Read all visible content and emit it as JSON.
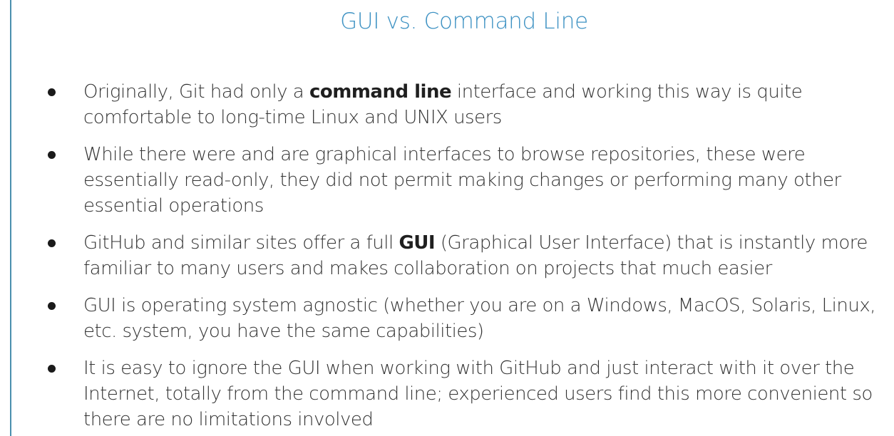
{
  "slide": {
    "title": "GUI vs. Command Line",
    "bullets": [
      {
        "before": "Originally, Git had only a ",
        "bold": "command line",
        "after": " interface and working this way is quite comfortable to long-time Linux and UNIX users"
      },
      {
        "text": "While there were and are graphical interfaces to browse repositories, these were essentially read-only, they did not permit making changes or performing many other essential operations"
      },
      {
        "before": "GitHub and similar sites offer a full ",
        "bold": "GUI",
        "after": " (Graphical User Interface) that is instantly more familiar to many users and makes collaboration on projects that much easier"
      },
      {
        "text": "GUI is operating system agnostic (whether you are on a Windows, MacOS, Solaris, Linux, etc. system, you have the same capabilities)"
      },
      {
        "text": "It is easy to ignore the GUI when working with GitHub and just interact with it over the Internet, totally from the command line; experienced users find this more convenient so there are no limitations involved"
      }
    ]
  }
}
